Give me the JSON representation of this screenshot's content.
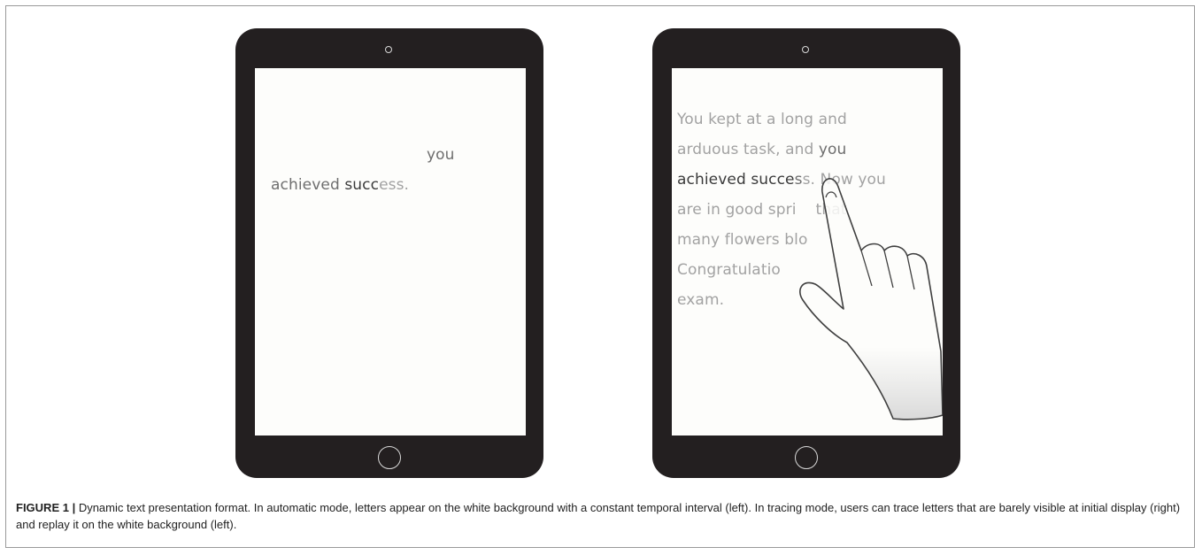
{
  "left_tablet": {
    "screen_lines": [
      {
        "parts": [
          {
            "text": "you",
            "tone": "mid"
          }
        ]
      },
      {
        "parts": [
          {
            "text": "achieved ",
            "tone": "mid"
          },
          {
            "text": "succ",
            "tone": "dark"
          },
          {
            "text": "ess.",
            "tone": "light"
          }
        ]
      }
    ]
  },
  "right_tablet": {
    "screen_lines": [
      {
        "parts": [
          {
            "text": "You kept at a long and",
            "tone": "light"
          }
        ]
      },
      {
        "parts": [
          {
            "text": "arduous task, and ",
            "tone": "light"
          },
          {
            "text": "you",
            "tone": "mid"
          }
        ]
      },
      {
        "parts": [
          {
            "text": "achieved succe",
            "tone": "dark"
          },
          {
            "text": "s",
            "tone": "mid"
          },
          {
            "text": "s. Now you",
            "tone": "light"
          }
        ]
      },
      {
        "parts": [
          {
            "text": "are in good spri",
            "tone": "light"
          },
          {
            "text": "    that",
            "tone": "light"
          }
        ]
      },
      {
        "parts": [
          {
            "text": "many flowers blo",
            "tone": "light"
          }
        ]
      },
      {
        "parts": [
          {
            "text": "Congratulatio",
            "tone": "light"
          }
        ]
      },
      {
        "parts": [
          {
            "text": "exam.",
            "tone": "light"
          }
        ]
      }
    ]
  },
  "caption": {
    "label": "FIGURE 1 |",
    "text": " Dynamic text presentation format. In automatic mode, letters appear on the white background with a constant temporal interval (left). In tracing mode, users can trace letters that are barely visible at initial display (right) and replay it on the white background (left)."
  },
  "colors": {
    "tablet_body": "#231f20",
    "screen": "#fdfdfb",
    "text_light": "#a2a2a2",
    "text_mid": "#6e6e6e",
    "text_dark": "#3a3a3a"
  }
}
